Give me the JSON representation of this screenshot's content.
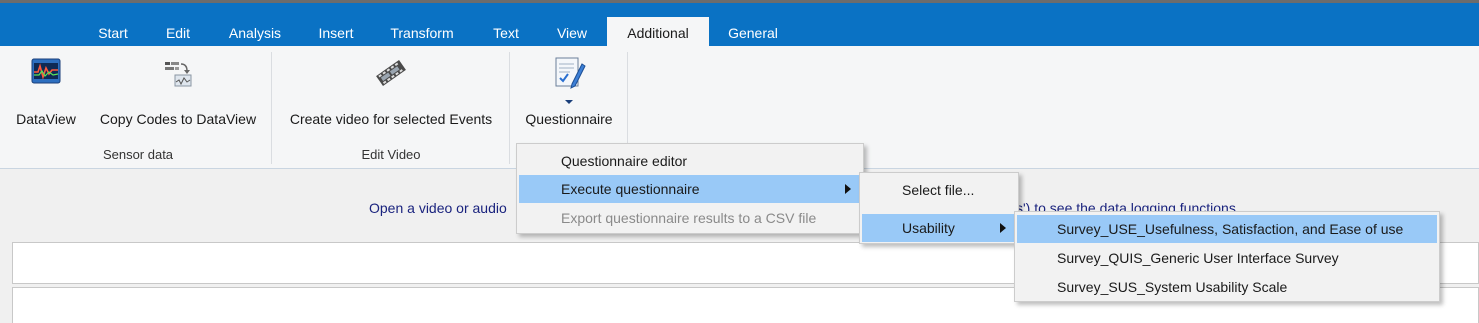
{
  "tabs": [
    "Start",
    "Edit",
    "Analysis",
    "Insert",
    "Transform",
    "Text",
    "View",
    "Additional",
    "General"
  ],
  "active_tab": "Additional",
  "ribbon": {
    "dataview_label": "DataView",
    "copy_codes_label": "Copy Codes to DataView",
    "create_video_label": "Create video for selected Events",
    "questionnaire_label": "Questionnaire",
    "group_sensor": "Sensor data",
    "group_edit_video": "Edit Video"
  },
  "hint": {
    "left": "Open a video or audio",
    "right": "s') to see the data logging functions."
  },
  "questionnaire_menu": {
    "items": [
      "Questionnaire editor",
      "Execute questionnaire",
      "Export questionnaire results to a CSV file"
    ]
  },
  "execute_submenu": {
    "items": [
      "Select file...",
      "Usability"
    ]
  },
  "usability_submenu": {
    "items": [
      "Survey_USE_Usefulness, Satisfaction, and Ease of use",
      "Survey_QUIS_Generic User Interface Survey",
      "Survey_SUS_System Usability Scale"
    ]
  },
  "colors": {
    "tabbar": "#0a72c4",
    "highlight": "#99c9f7",
    "hint_text": "#1a237e"
  }
}
